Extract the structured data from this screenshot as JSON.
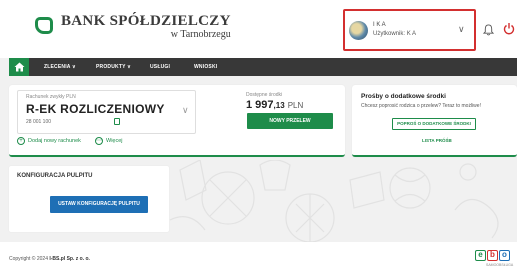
{
  "header": {
    "bank_name": "BANK SPÓŁDZIELCZY",
    "bank_location": "w Tarnobrzegu",
    "user": {
      "name": "I K A",
      "login_label": "Użytkownik:",
      "login_value": "K A"
    }
  },
  "nav": {
    "items": [
      {
        "label": "ZLECENIA ∨"
      },
      {
        "label": "PRODUKTY ∨"
      },
      {
        "label": "USŁUGI"
      },
      {
        "label": "WNIOSKI"
      }
    ]
  },
  "account": {
    "type_label": "Rachunek zwykły PLN",
    "name": "R-EK ROZLICZENIOWY",
    "number": "28 001 100",
    "add_account": "Dodaj nowy rachunek",
    "more": "Więcej",
    "funds_label": "Dostępne środki",
    "funds_main": "1 997",
    "funds_decimal": ",13",
    "funds_currency": "PLN",
    "transfer_button": "NOWY PRZELEW"
  },
  "requests": {
    "title": "Prośby o dodatkowe środki",
    "text": "Chcesz poprosić rodzica o przelew? Teraz to możliwe!",
    "ask_button": "POPROŚ O DODATKOWE ŚRODKI",
    "list_link": "LISTA PRÓŚB"
  },
  "config": {
    "title": "KONFIGURACJA PULPITU",
    "button": "USTAW KONFIGURACJĘ PULPITU"
  },
  "footer": {
    "copyright_prefix": "Copyright © 2024",
    "company": "I-BS.pl Sp. z o. o.",
    "logo_letters": [
      "e",
      "b",
      "o"
    ],
    "logo_sub": "SAMOOBSŁUGA"
  },
  "colors": {
    "brand_green": "#1e8c4a",
    "nav_dark": "#383838",
    "config_blue": "#1e6fb5",
    "highlight_red": "#d32f2f",
    "ebo_green": "#1e8c4a",
    "ebo_red": "#d32f2f",
    "ebo_blue": "#1e6fb5"
  }
}
